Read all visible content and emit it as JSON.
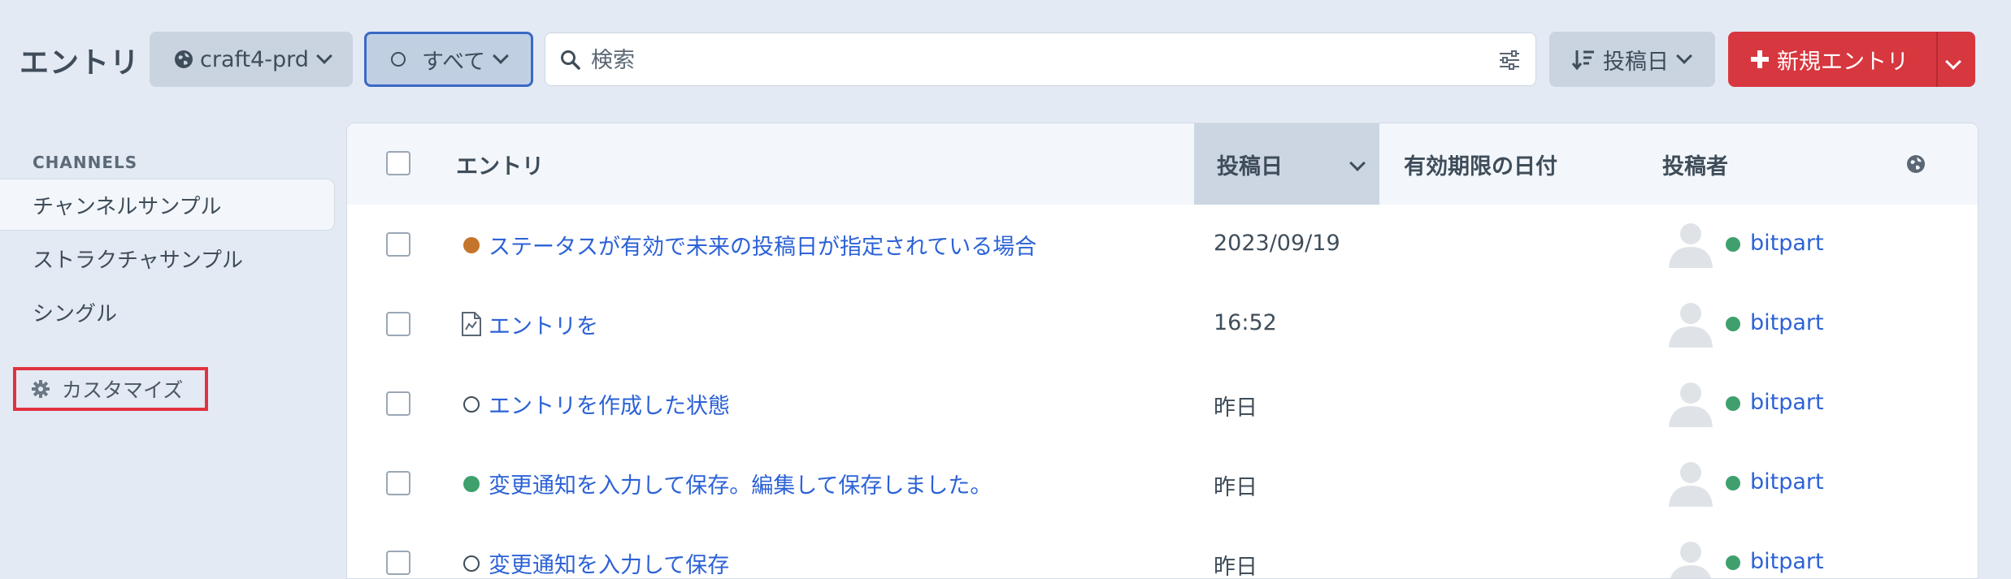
{
  "header": {
    "title": "エントリ",
    "site_label": "craft4-prd",
    "status_label": "すべて",
    "search_placeholder": "検索",
    "sort_label": "投稿日",
    "new_entry_label": "新規エントリ"
  },
  "sidebar": {
    "heading": "CHANNELS",
    "items": [
      {
        "label": "チャンネルサンプル",
        "active": true
      },
      {
        "label": "ストラクチャサンプル",
        "active": false
      },
      {
        "label": "シングル",
        "active": false
      }
    ],
    "customize_label": "カスタマイズ"
  },
  "table": {
    "columns": {
      "title": "エントリ",
      "post_date": "投稿日",
      "expiry_date": "有効期限の日付",
      "author": "投稿者"
    },
    "rows": [
      {
        "status": "pending",
        "title": "ステータスが有効で未来の投稿日が指定されている場合",
        "post_date": "2023/09/19",
        "author": "bitpart"
      },
      {
        "status": "draft",
        "title": "エントリを",
        "post_date": "16:52",
        "author": "bitpart"
      },
      {
        "status": "disabled",
        "title": "エントリを作成した状態",
        "post_date": "昨日",
        "author": "bitpart"
      },
      {
        "status": "live",
        "title": "変更通知を入力して保存。編集して保存しました。",
        "post_date": "昨日",
        "author": "bitpart"
      },
      {
        "status": "disabled",
        "title": "変更通知を入力して保存",
        "post_date": "昨日",
        "author": "bitpart"
      }
    ]
  },
  "colors": {
    "pending": "#c5752b",
    "live": "#3fa06e",
    "link": "#2c62d6",
    "primary": "#d7373f"
  }
}
